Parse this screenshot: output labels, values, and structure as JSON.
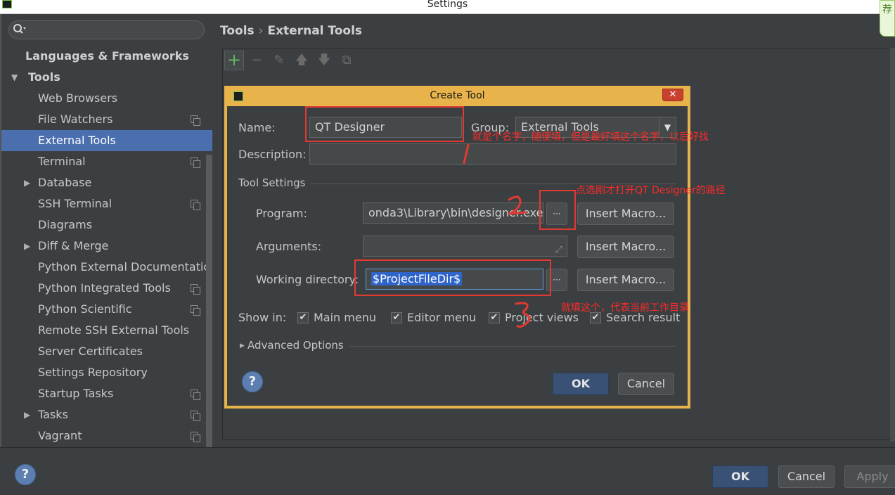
{
  "window": {
    "title": "Settings",
    "corner_widget_text": "荐"
  },
  "sidebar": {
    "search_placeholder": "",
    "items": [
      {
        "label": "Languages & Frameworks",
        "level": 0,
        "bold": true,
        "arrow": "",
        "copy_icon": false,
        "selected": false
      },
      {
        "label": "Tools",
        "level": 0,
        "bold": true,
        "arrow": "▼",
        "copy_icon": false,
        "selected": false
      },
      {
        "label": "Web Browsers",
        "level": 1,
        "bold": false,
        "arrow": "",
        "copy_icon": false,
        "selected": false
      },
      {
        "label": "File Watchers",
        "level": 1,
        "bold": false,
        "arrow": "",
        "copy_icon": true,
        "selected": false
      },
      {
        "label": "External Tools",
        "level": 1,
        "bold": false,
        "arrow": "",
        "copy_icon": false,
        "selected": true
      },
      {
        "label": "Terminal",
        "level": 1,
        "bold": false,
        "arrow": "",
        "copy_icon": true,
        "selected": false
      },
      {
        "label": "Database",
        "level": 1,
        "bold": false,
        "arrow": "▶",
        "copy_icon": false,
        "selected": false
      },
      {
        "label": "SSH Terminal",
        "level": 1,
        "bold": false,
        "arrow": "",
        "copy_icon": true,
        "selected": false
      },
      {
        "label": "Diagrams",
        "level": 1,
        "bold": false,
        "arrow": "",
        "copy_icon": false,
        "selected": false
      },
      {
        "label": "Diff & Merge",
        "level": 1,
        "bold": false,
        "arrow": "▶",
        "copy_icon": false,
        "selected": false
      },
      {
        "label": "Python External Documentatic",
        "level": 1,
        "bold": false,
        "arrow": "",
        "copy_icon": false,
        "selected": false
      },
      {
        "label": "Python Integrated Tools",
        "level": 1,
        "bold": false,
        "arrow": "",
        "copy_icon": true,
        "selected": false
      },
      {
        "label": "Python Scientific",
        "level": 1,
        "bold": false,
        "arrow": "",
        "copy_icon": true,
        "selected": false
      },
      {
        "label": "Remote SSH External Tools",
        "level": 1,
        "bold": false,
        "arrow": "",
        "copy_icon": false,
        "selected": false
      },
      {
        "label": "Server Certificates",
        "level": 1,
        "bold": false,
        "arrow": "",
        "copy_icon": false,
        "selected": false
      },
      {
        "label": "Settings Repository",
        "level": 1,
        "bold": false,
        "arrow": "",
        "copy_icon": false,
        "selected": false
      },
      {
        "label": "Startup Tasks",
        "level": 1,
        "bold": false,
        "arrow": "",
        "copy_icon": true,
        "selected": false
      },
      {
        "label": "Tasks",
        "level": 1,
        "bold": false,
        "arrow": "▶",
        "copy_icon": true,
        "selected": false
      },
      {
        "label": "Vagrant",
        "level": 1,
        "bold": false,
        "arrow": "",
        "copy_icon": true,
        "selected": false
      }
    ]
  },
  "breadcrumb": {
    "parent": "Tools",
    "separator": "›",
    "current": "External Tools"
  },
  "toolbar": {
    "add": "+",
    "remove": "−",
    "edit": "✎",
    "up": "🡅",
    "down": "🡇",
    "copy": "⧉"
  },
  "dialog": {
    "title": "Create Tool",
    "close": "✕",
    "name_label": "Name:",
    "name_value": "QT Designer",
    "group_label": "Group:",
    "group_value": "External Tools",
    "description_label": "Description:",
    "description_value": "",
    "tool_settings_label": "Tool Settings",
    "program_label": "Program:",
    "program_value": "onda3\\Library\\bin\\designer.exe",
    "browse_label": "···",
    "insert_macro_label": "Insert Macro...",
    "arguments_label": "Arguments:",
    "arguments_value": "",
    "workdir_label": "Working directory:",
    "workdir_value": "$ProjectFileDir$",
    "show_in_label": "Show in:",
    "show_in": [
      {
        "label": "Main menu",
        "checked": true
      },
      {
        "label": "Editor menu",
        "checked": true
      },
      {
        "label": "Project views",
        "checked": true
      },
      {
        "label": "Search result",
        "checked": true
      }
    ],
    "advanced_label": "Advanced Options",
    "ok_label": "OK",
    "cancel_label": "Cancel",
    "help_label": "?"
  },
  "annotations": {
    "note_name": "就是个名字，随便填，但是最好填这个名字，以后好找",
    "note_program": "点选刚才打开QT Designer的路径",
    "note_workdir": "就填这个，代表当前工作目录"
  },
  "footer": {
    "help_label": "?",
    "ok_label": "OK",
    "cancel_label": "Cancel",
    "apply_label": "Apply"
  },
  "colors": {
    "selection": "#4b6eaf",
    "dialog_border": "#e8b34a",
    "annotation": "#e23a31",
    "primary_button": "#385174"
  }
}
